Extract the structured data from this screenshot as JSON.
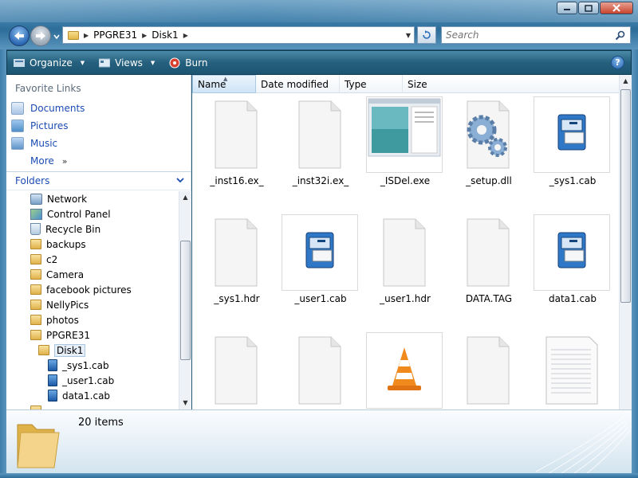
{
  "window": {
    "caption_buttons": [
      "minimize",
      "maximize",
      "close"
    ]
  },
  "address": {
    "crumbs": [
      "PPGRE31",
      "Disk1"
    ]
  },
  "search": {
    "placeholder": "Search"
  },
  "toolbar": {
    "organize": "Organize",
    "views": "Views",
    "burn": "Burn",
    "help": "?"
  },
  "favorites": {
    "title": "Favorite Links",
    "items": [
      "Documents",
      "Pictures",
      "Music"
    ],
    "more": "More"
  },
  "folders": {
    "title": "Folders",
    "tree": [
      {
        "label": "Network",
        "icon": "network-icon"
      },
      {
        "label": "Control Panel",
        "icon": "control-panel-icon"
      },
      {
        "label": "Recycle Bin",
        "icon": "recycle-bin-icon"
      },
      {
        "label": "backups",
        "icon": "folder-icon"
      },
      {
        "label": "c2",
        "icon": "folder-icon"
      },
      {
        "label": "Camera",
        "icon": "folder-icon"
      },
      {
        "label": "facebook pictures",
        "icon": "folder-icon"
      },
      {
        "label": "NellyPics",
        "icon": "folder-icon"
      },
      {
        "label": "photos",
        "icon": "folder-icon"
      },
      {
        "label": "PPGRE31",
        "icon": "folder-icon"
      },
      {
        "label": "Disk1",
        "icon": "folder-icon",
        "selected": true
      },
      {
        "label": "_sys1.cab",
        "icon": "cabinet-icon"
      },
      {
        "label": "_user1.cab",
        "icon": "cabinet-icon"
      },
      {
        "label": "data1.cab",
        "icon": "cabinet-icon"
      }
    ]
  },
  "columns": [
    "Name",
    "Date modified",
    "Type",
    "Size"
  ],
  "files": [
    {
      "name": "_inst16.ex_",
      "icon": "blank-file-icon"
    },
    {
      "name": "_inst32i.ex_",
      "icon": "blank-file-icon"
    },
    {
      "name": "_ISDel.exe",
      "icon": "window-app-icon"
    },
    {
      "name": "_setup.dll",
      "icon": "gears-icon"
    },
    {
      "name": "_sys1.cab",
      "icon": "cabinet-icon"
    },
    {
      "name": "_sys1.hdr",
      "icon": "blank-file-icon"
    },
    {
      "name": "_user1.cab",
      "icon": "cabinet-icon"
    },
    {
      "name": "_user1.hdr",
      "icon": "blank-file-icon"
    },
    {
      "name": "DATA.TAG",
      "icon": "blank-file-icon"
    },
    {
      "name": "data1.cab",
      "icon": "cabinet-icon"
    },
    {
      "name": "",
      "icon": "blank-file-icon"
    },
    {
      "name": "",
      "icon": "blank-file-icon"
    },
    {
      "name": "",
      "icon": "traffic-cone-icon"
    },
    {
      "name": "",
      "icon": "blank-file-icon"
    },
    {
      "name": "",
      "icon": "text-file-icon"
    }
  ],
  "details": {
    "count": "20 items"
  }
}
